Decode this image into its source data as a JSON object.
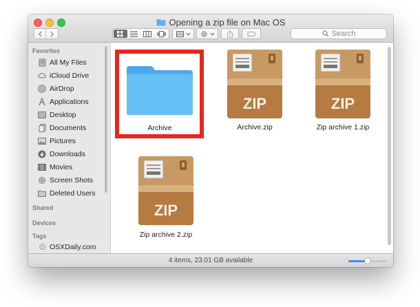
{
  "window": {
    "title": "Opening a zip file on Mac OS"
  },
  "toolbar": {
    "back_icon": "chevron-left-icon",
    "forward_icon": "chevron-right-icon",
    "view_modes": [
      "icon-view-icon",
      "list-view-icon",
      "column-view-icon",
      "cover-flow-icon"
    ],
    "selected_view": "icon-view-icon",
    "search_placeholder": "Search"
  },
  "sidebar": {
    "favorites_heading": "Favorites",
    "items": [
      {
        "label": "All My Files",
        "icon": "all-files-icon"
      },
      {
        "label": "iCloud Drive",
        "icon": "cloud-icon"
      },
      {
        "label": "AirDrop",
        "icon": "airdrop-icon"
      },
      {
        "label": "Applications",
        "icon": "applications-icon"
      },
      {
        "label": "Desktop",
        "icon": "desktop-icon"
      },
      {
        "label": "Documents",
        "icon": "documents-icon"
      },
      {
        "label": "Pictures",
        "icon": "pictures-icon"
      },
      {
        "label": "Downloads",
        "icon": "downloads-icon"
      },
      {
        "label": "Movies",
        "icon": "movies-icon"
      },
      {
        "label": "Screen Shots",
        "icon": "gear-icon"
      },
      {
        "label": "Deleted Users",
        "icon": "folder-icon"
      }
    ],
    "shared_heading": "Shared",
    "devices_heading": "Devices",
    "tags_heading": "Tags",
    "tags": [
      {
        "label": "OSXDaily.com",
        "color": "#c8c8c8"
      }
    ]
  },
  "files": [
    {
      "name": "Archive",
      "type": "folder",
      "highlighted": true
    },
    {
      "name": "Archive.zip",
      "type": "zip",
      "badge": "ZIP"
    },
    {
      "name": "Zip archive 1.zip",
      "type": "zip",
      "badge": "ZIP"
    },
    {
      "name": "Zip archive 2.zip",
      "type": "zip",
      "badge": "ZIP"
    }
  ],
  "status": {
    "text": "4 items, 23.01 GB available",
    "zoom_level": 0.5
  },
  "colors": {
    "highlight_box": "#e8261c",
    "folder_blue": "#5cb7f0",
    "zip_brown": "#b87a3c",
    "accent": "#3f8df5"
  }
}
